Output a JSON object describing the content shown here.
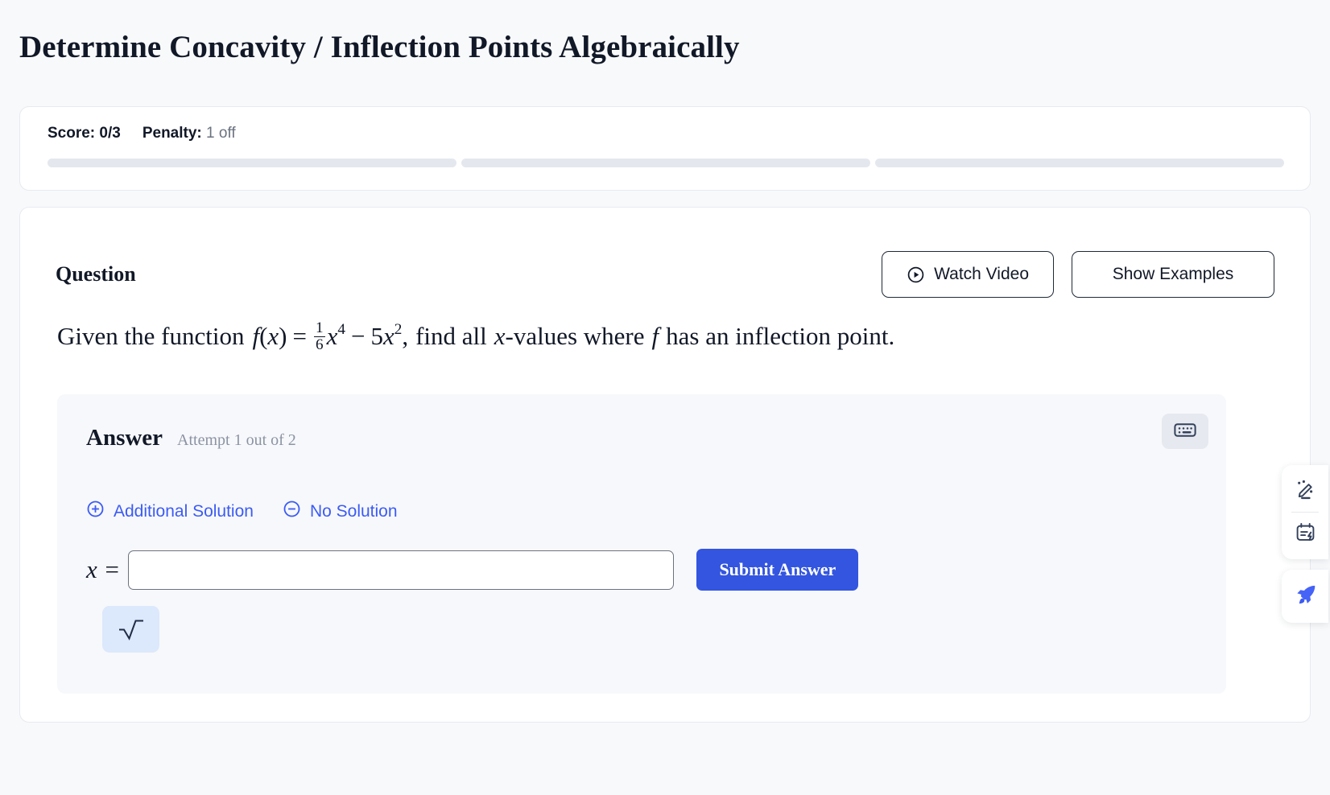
{
  "page": {
    "title": "Determine Concavity / Inflection Points Algebraically"
  },
  "score_card": {
    "score_label": "Score: 0/3",
    "penalty_label": "Penalty:",
    "penalty_value": "1 off",
    "progress_segments": 3,
    "progress_filled": 0,
    "progress_track_color": "#e4e8ee"
  },
  "question_section": {
    "heading": "Question",
    "watch_video_label": "Watch Video",
    "show_examples_label": "Show Examples",
    "prompt": {
      "lead": "Given the function",
      "f_name": "f",
      "open_paren": "(",
      "var": "x",
      "close_paren": ")",
      "equals": "=",
      "frac_num": "1",
      "frac_den": "6",
      "term1_var": "x",
      "term1_exp": "4",
      "minus": "−",
      "coef2": "5",
      "term2_var": "x",
      "term2_exp": "2",
      "comma": ",",
      "tail_a": "find all",
      "tail_var": "x",
      "tail_b": "-values where",
      "tail_f": "f",
      "tail_c": "has an inflection point."
    }
  },
  "answer_section": {
    "title": "Answer",
    "attempt_text": "Attempt 1 out of 2",
    "keyboard_icon": "keyboard-icon",
    "additional_solution_label": "Additional Solution",
    "additional_solution_icon": "plus-circle-icon",
    "no_solution_label": "No Solution",
    "no_solution_icon": "minus-circle-icon",
    "input_prefix": "x =",
    "input_value": "",
    "input_placeholder": "",
    "submit_label": "Submit Answer",
    "sqrt_button_icon": "square-root-icon",
    "accent_color": "#3355e0",
    "link_color": "#3b5bf5",
    "sqrt_button_bg": "#dce8fb"
  },
  "float_tools": {
    "items": [
      {
        "icon": "magic-pencil-icon"
      },
      {
        "icon": "calendar-bolt-icon"
      },
      {
        "icon": "rocket-icon"
      }
    ],
    "rocket_color": "#3b5bf5"
  }
}
